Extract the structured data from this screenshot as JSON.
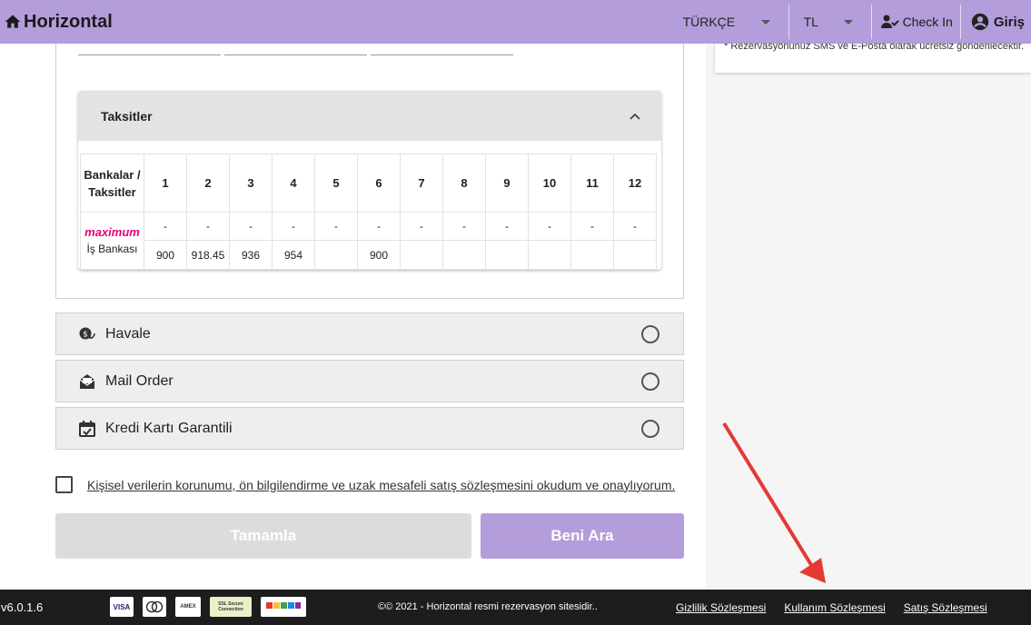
{
  "header": {
    "brand": "Horizontal",
    "language": "TÜRKÇE",
    "currency": "TL",
    "checkin_label": "Check In",
    "login_label": "Giriş"
  },
  "installments": {
    "title": "Taksitler",
    "corner_label": "Bankalar / Taksitler",
    "columns": [
      "1",
      "2",
      "3",
      "4",
      "5",
      "6",
      "7",
      "8",
      "9",
      "10",
      "11",
      "12"
    ],
    "bank_logo_text": "maximum",
    "bank_name": "İş Bankası",
    "row1": [
      "-",
      "-",
      "-",
      "-",
      "-",
      "-",
      "-",
      "-",
      "-",
      "-",
      "-",
      "-"
    ],
    "row2": [
      "900",
      "918.45",
      "936",
      "954",
      "",
      "900",
      "",
      "",
      "",
      "",
      "",
      ""
    ]
  },
  "payment_options": [
    {
      "label": "Havale",
      "icon": "money-exchange-icon"
    },
    {
      "label": "Mail Order",
      "icon": "mail-open-icon"
    },
    {
      "label": "Kredi Kartı Garantili",
      "icon": "calendar-check-icon"
    }
  ],
  "consent_text": "Kişisel verilerin korunumu, ön bilgilendirme ve uzak mesafeli satış sözleşmesini okudum ve onaylıyorum.",
  "buttons": {
    "complete": "Tamamla",
    "call_me": "Beni Ara"
  },
  "right_note": "* Rezervasyonunuz SMS ve E-Posta olarak ücretsiz gönderilecektir.",
  "footer": {
    "version": "v6.0.1.6",
    "card_logos": [
      "VISA",
      "mastercard",
      "AMEX",
      "SSL Secure Connection",
      "secure payment"
    ],
    "copyright": "©© 2021 - Horizontal resmi rezervasyon sitesidir..",
    "links": [
      "Gizlilik Sözleşmesi",
      "Kullanım Sözleşmesi",
      "Satış Sözleşmesi"
    ]
  },
  "colors": {
    "accent": "#b39ddb",
    "annotation_arrow": "#e53935"
  }
}
